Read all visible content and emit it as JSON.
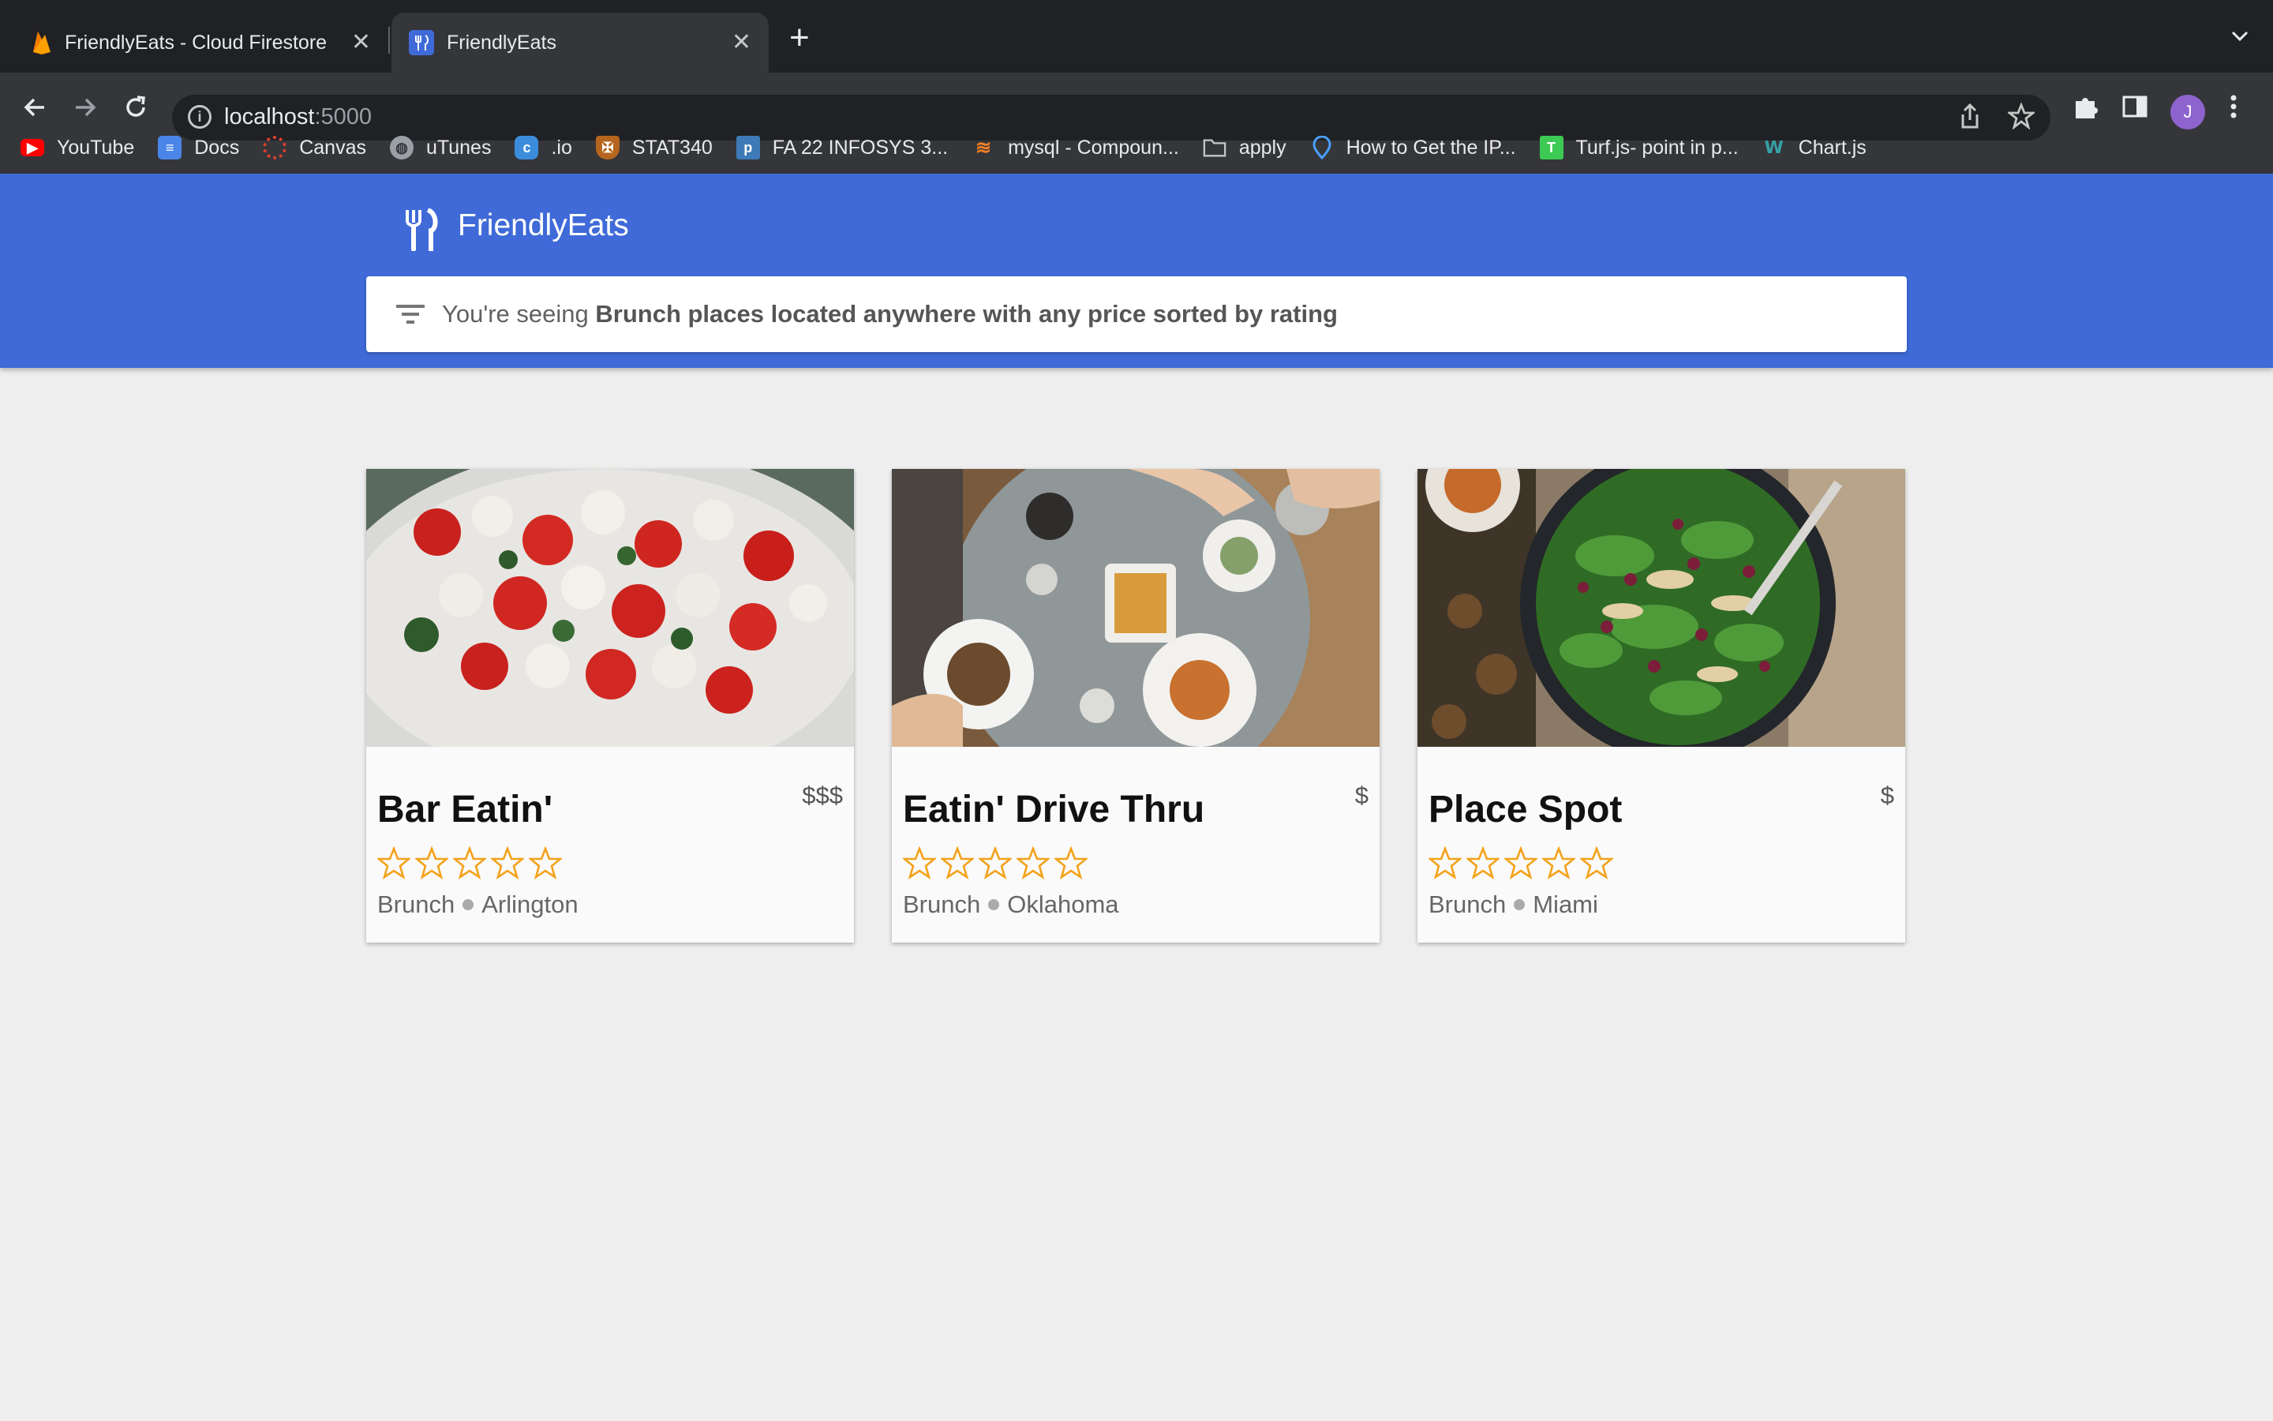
{
  "browser": {
    "tabs": [
      {
        "title": "FriendlyEats - Cloud Firestore",
        "icon": "firebase-icon",
        "active": false
      },
      {
        "title": "FriendlyEats",
        "icon": "friendlyeats-icon",
        "active": true
      }
    ],
    "new_tab": "+",
    "url_host": "localhost",
    "url_port": ":5000",
    "avatar_initial": "J",
    "bookmarks": [
      {
        "label": "YouTube",
        "icon": "youtube-icon",
        "color": "#ff0000"
      },
      {
        "label": "Docs",
        "icon": "docs-icon",
        "color": "#4a86e8"
      },
      {
        "label": "Canvas",
        "icon": "canvas-icon",
        "color": "#e13f2b"
      },
      {
        "label": "uTunes",
        "icon": "globe-icon",
        "color": "#9aa0a6"
      },
      {
        "label": ".io",
        "icon": "io-icon",
        "color": "#3b8ddc"
      },
      {
        "label": "STAT340",
        "icon": "crest-icon",
        "color": "#b5651d"
      },
      {
        "label": "FA 22 INFOSYS 3...",
        "icon": "piazza-icon",
        "color": "#3e7ab8"
      },
      {
        "label": "mysql - Compoun...",
        "icon": "stackoverflow-icon",
        "color": "#f48024"
      },
      {
        "label": "apply",
        "icon": "folder-icon",
        "color": "#c4c7c5"
      },
      {
        "label": "How to Get the IP...",
        "icon": "location-icon",
        "color": "#4a9eff"
      },
      {
        "label": "Turf.js- point in p...",
        "icon": "turf-icon",
        "color": "#3cc954"
      },
      {
        "label": "Chart.js",
        "icon": "chartjs-icon",
        "color": "#36a2a6"
      }
    ]
  },
  "app": {
    "title": "FriendlyEats",
    "filter": {
      "prefix": "You're seeing ",
      "description": "Brunch places located anywhere with any price sorted by rating"
    },
    "accent": "#3f6ad8"
  },
  "restaurants": [
    {
      "name": "Bar Eatin'",
      "price": "$$$",
      "category": "Brunch",
      "city": "Arlington",
      "rating": 0,
      "image": "caprese-salad-photo"
    },
    {
      "name": "Eatin' Drive Thru",
      "price": "$",
      "category": "Brunch",
      "city": "Oklahoma",
      "rating": 0,
      "image": "brunch-table-photo"
    },
    {
      "name": "Place Spot",
      "price": "$",
      "category": "Brunch",
      "city": "Miami",
      "rating": 0,
      "image": "spinach-salad-photo"
    }
  ]
}
